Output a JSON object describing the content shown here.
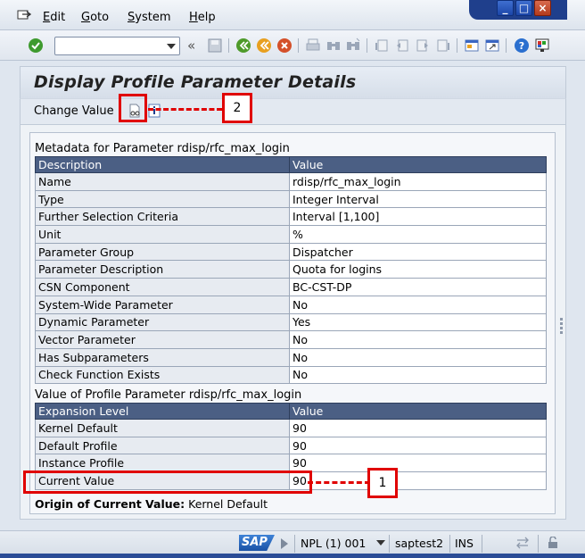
{
  "menu": {
    "items": [
      {
        "label": "Edit",
        "underline": "E",
        "rest": "dit"
      },
      {
        "label": "Goto",
        "underline": "G",
        "rest": "oto"
      },
      {
        "label": "System",
        "underline": "S",
        "rest": "ystem"
      },
      {
        "label": "Help",
        "underline": "H",
        "rest": "elp"
      }
    ]
  },
  "window_controls": {
    "minimize": "_",
    "maximize": "□",
    "close": "×"
  },
  "toolbar": {
    "command_field_value": "",
    "back_double": "«"
  },
  "title": "Display Profile Parameter Details",
  "app_toolbar": {
    "change_value_label": "Change Value"
  },
  "metadata": {
    "section_title": "Metadata for Parameter rdisp/rfc_max_login",
    "columns": [
      "Description",
      "Value"
    ],
    "rows": [
      {
        "key": "Name",
        "value": "rdisp/rfc_max_login"
      },
      {
        "key": "Type",
        "value": "Integer Interval"
      },
      {
        "key": "Further Selection Criteria",
        "value": "Interval [1,100]"
      },
      {
        "key": "Unit",
        "value": "%"
      },
      {
        "key": "Parameter Group",
        "value": "Dispatcher"
      },
      {
        "key": "Parameter Description",
        "value": "Quota for logins"
      },
      {
        "key": "CSN Component",
        "value": "BC-CST-DP"
      },
      {
        "key": "System-Wide Parameter",
        "value": "No"
      },
      {
        "key": "Dynamic Parameter",
        "value": "Yes"
      },
      {
        "key": "Vector Parameter",
        "value": "No"
      },
      {
        "key": "Has Subparameters",
        "value": "No"
      },
      {
        "key": "Check Function Exists",
        "value": "No"
      }
    ]
  },
  "values": {
    "section_title": "Value of Profile Parameter rdisp/rfc_max_login",
    "columns": [
      "Expansion Level",
      "Value"
    ],
    "rows": [
      {
        "key": "Kernel Default",
        "value": "90"
      },
      {
        "key": "Default Profile",
        "value": "90"
      },
      {
        "key": "Instance Profile",
        "value": "90"
      },
      {
        "key": "Current Value",
        "value": "90"
      }
    ]
  },
  "origin": {
    "label": "Origin of Current Value:",
    "value": "Kernel Default"
  },
  "statusbar": {
    "logo": "SAP",
    "system": "NPL (1) 001",
    "host": "saptest2",
    "mode": "INS"
  },
  "annotations": {
    "callout1": "1",
    "callout2": "2"
  },
  "colors": {
    "annotation_red": "#e00000",
    "table_header": "#4b5f84",
    "sap_blue": "#1a52a6"
  }
}
